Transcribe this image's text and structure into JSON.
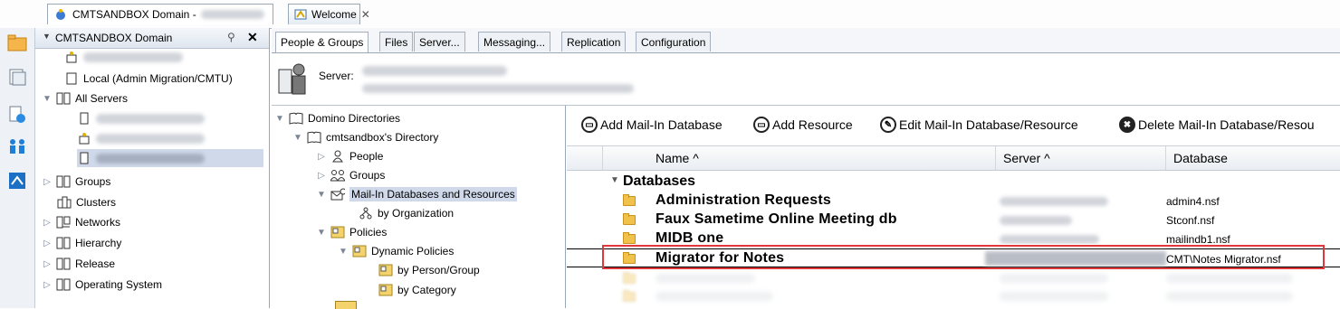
{
  "window_tabs": [
    {
      "label": "CMTSANDBOX Domain -",
      "active": true
    },
    {
      "label": "Welcome",
      "active": false
    }
  ],
  "left_panel": {
    "title": "CMTSANDBOX Domain",
    "tree": {
      "local": "Local (Admin Migration/CMTU)",
      "all_servers": "All Servers",
      "groups": "Groups",
      "clusters": "Clusters",
      "networks": "Networks",
      "hierarchy": "Hierarchy",
      "release": "Release",
      "operating_system": "Operating System"
    }
  },
  "sub_tabs": [
    "People & Groups",
    "Files",
    "Server...",
    "Messaging...",
    "Replication",
    "Configuration"
  ],
  "server_label": "Server:",
  "nav": {
    "domino_directories": "Domino Directories",
    "directory": "cmtsandbox's Directory",
    "people": "People",
    "groups": "Groups",
    "mail_in": "Mail-In Databases and Resources",
    "by_org": "by Organization",
    "policies": "Policies",
    "dynamic_policies": "Dynamic Policies",
    "by_person": "by Person/Group",
    "by_category": "by Category"
  },
  "actions": {
    "add_mailin": "Add Mail-In Database",
    "add_resource": "Add Resource",
    "edit": "Edit Mail-In Database/Resource",
    "delete": "Delete Mail-In Database/Resou"
  },
  "columns": {
    "name": "Name ^",
    "server": "Server ^",
    "database": "Database"
  },
  "category": "Databases",
  "rows": [
    {
      "name": "Administration Requests",
      "database": "admin4.nsf"
    },
    {
      "name": "Faux Sametime Online Meeting db",
      "database": "Stconf.nsf"
    },
    {
      "name": "MIDB one",
      "database": "mailindb1.nsf"
    },
    {
      "name": "Migrator for Notes",
      "database": "CMT\\Notes Migrator.nsf"
    }
  ],
  "colors": {
    "highlight": "#e0373a",
    "selection": "#cfd9ea"
  }
}
